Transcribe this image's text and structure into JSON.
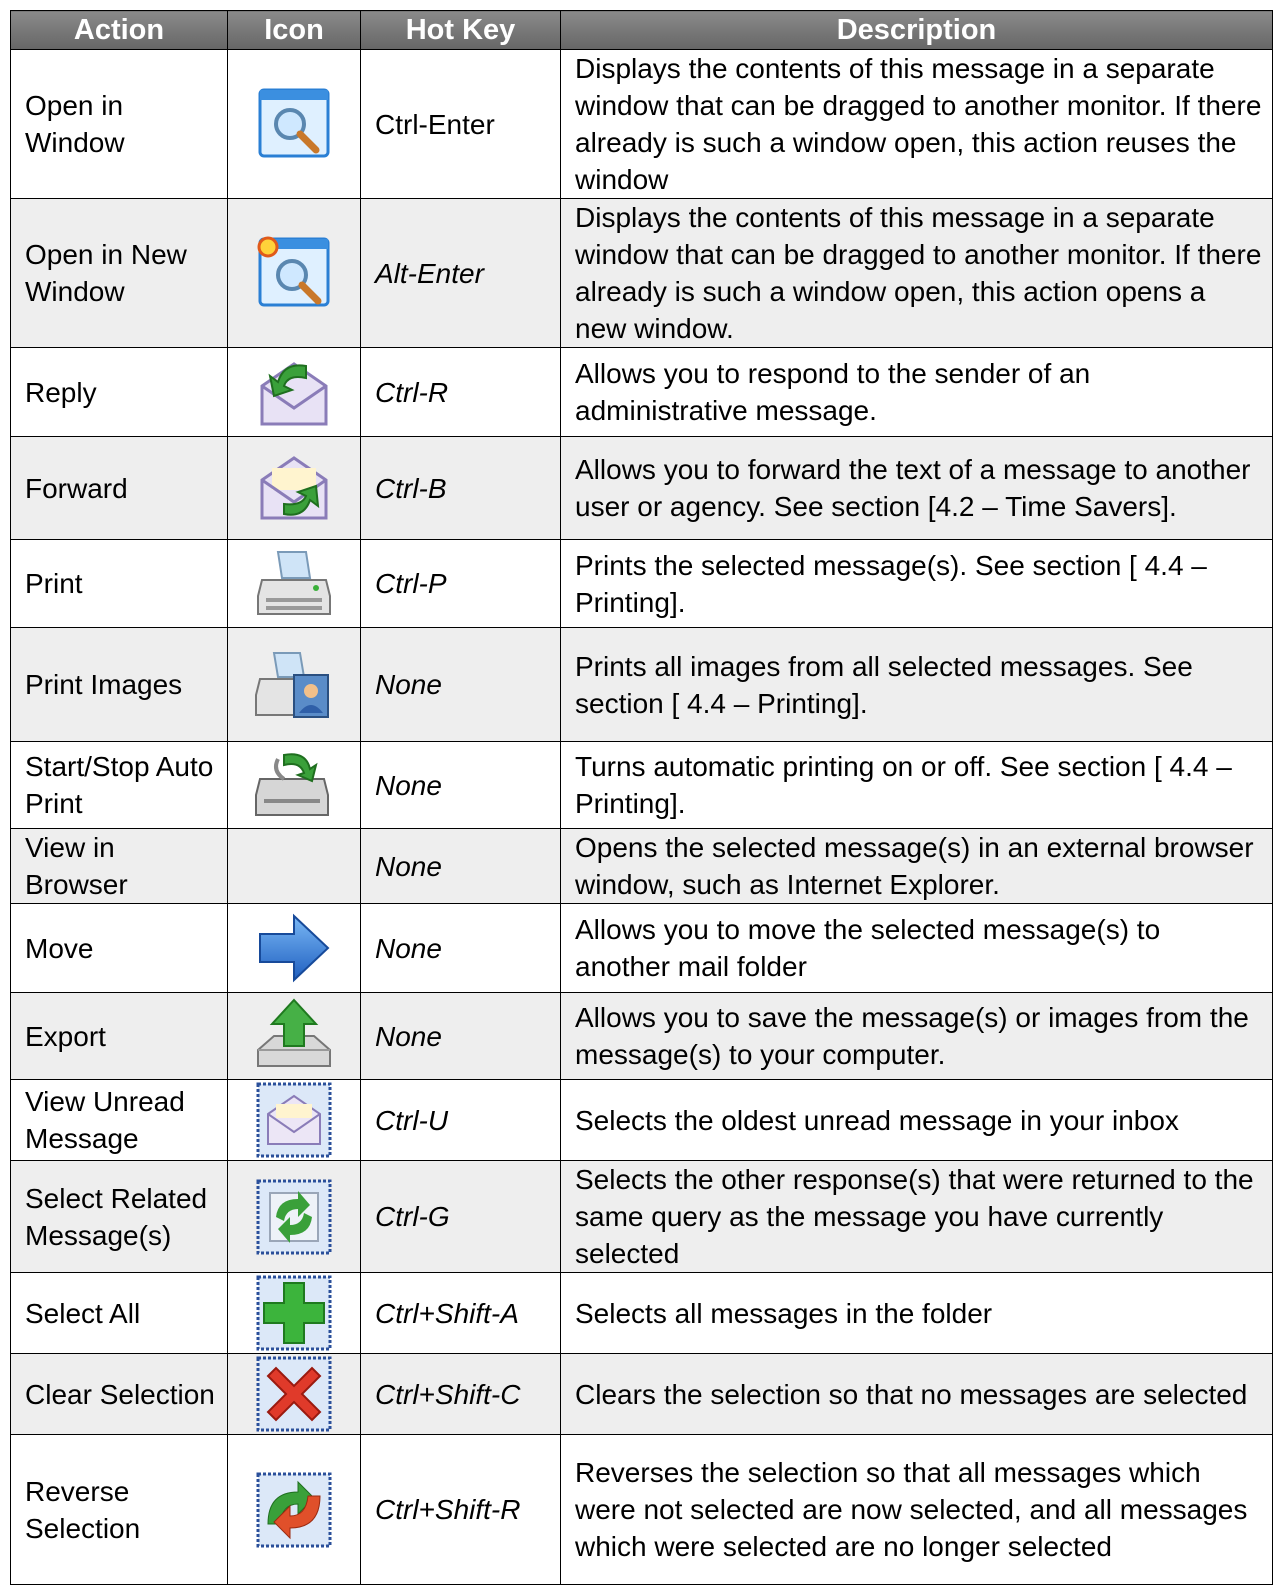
{
  "headers": {
    "action": "Action",
    "icon": "Icon",
    "hotkey": "Hot Key",
    "description": "Description"
  },
  "rows": [
    {
      "action": "Open in Window",
      "icon": "window-magnifier-icon",
      "hotkey": "Ctrl-Enter",
      "description": "Displays the contents of this message in a separate window that can be dragged to another monitor.  If there already is such a window open, this action reuses the window"
    },
    {
      "action": "Open in New Window",
      "icon": "new-window-magnifier-icon",
      "hotkey": "Alt-Enter",
      "description": "Displays the contents of this message in a separate window that can be dragged to another monitor.  If there already is such a window open, this action opens a new window."
    },
    {
      "action": "Reply",
      "icon": "reply-envelope-icon",
      "hotkey": "Ctrl-R",
      "description": "Allows you to respond to the sender of an administrative message."
    },
    {
      "action": "Forward",
      "icon": "forward-envelope-icon",
      "hotkey": "Ctrl-B",
      "description": "Allows you to forward the text of a message to another user or agency.  See section [4.2 – Time Savers]."
    },
    {
      "action": "Print",
      "icon": "printer-icon",
      "hotkey": "Ctrl-P",
      "description": "Prints the selected message(s).  See section [ 4.4 – Printing]."
    },
    {
      "action": "Print Images",
      "icon": "print-images-icon",
      "hotkey": "None",
      "description": "Prints all images from all selected messages.  See section [ 4.4 – Printing]."
    },
    {
      "action": "Start/Stop Auto Print",
      "icon": "auto-print-icon",
      "hotkey": "None",
      "description": "Turns automatic printing on or off.  See section [ 4.4 – Printing]."
    },
    {
      "action": "View in Browser",
      "icon": "",
      "hotkey": "None",
      "description": "Opens the selected message(s) in an external browser window, such as Internet Explorer."
    },
    {
      "action": "Move",
      "icon": "move-arrow-icon",
      "hotkey": "None",
      "description": "Allows you to move the selected message(s) to another mail folder"
    },
    {
      "action": "Export",
      "icon": "export-icon",
      "hotkey": "None",
      "description": "Allows you to save the message(s) or images from the message(s) to your computer."
    },
    {
      "action": "View Unread Message",
      "icon": "unread-envelope-icon",
      "hotkey": "Ctrl-U",
      "description": "Selects the oldest unread message in your inbox"
    },
    {
      "action": "Select Related Message(s)",
      "icon": "related-messages-icon",
      "hotkey": "Ctrl-G",
      "description": "Selects the other response(s) that were returned to the same query as the message you have currently selected"
    },
    {
      "action": "Select All",
      "icon": "select-all-plus-icon",
      "hotkey": "Ctrl+Shift-A",
      "description": "Selects all messages in the folder"
    },
    {
      "action": "Clear Selection",
      "icon": "clear-selection-x-icon",
      "hotkey": "Ctrl+Shift-C",
      "description": "Clears the selection so that no messages are selected"
    },
    {
      "action": "Reverse Selection",
      "icon": "reverse-selection-icon",
      "hotkey": "Ctrl+Shift-R",
      "description": "Reverses the selection so that all messages which were not selected are now selected, and all messages which were selected are no longer selected"
    }
  ]
}
